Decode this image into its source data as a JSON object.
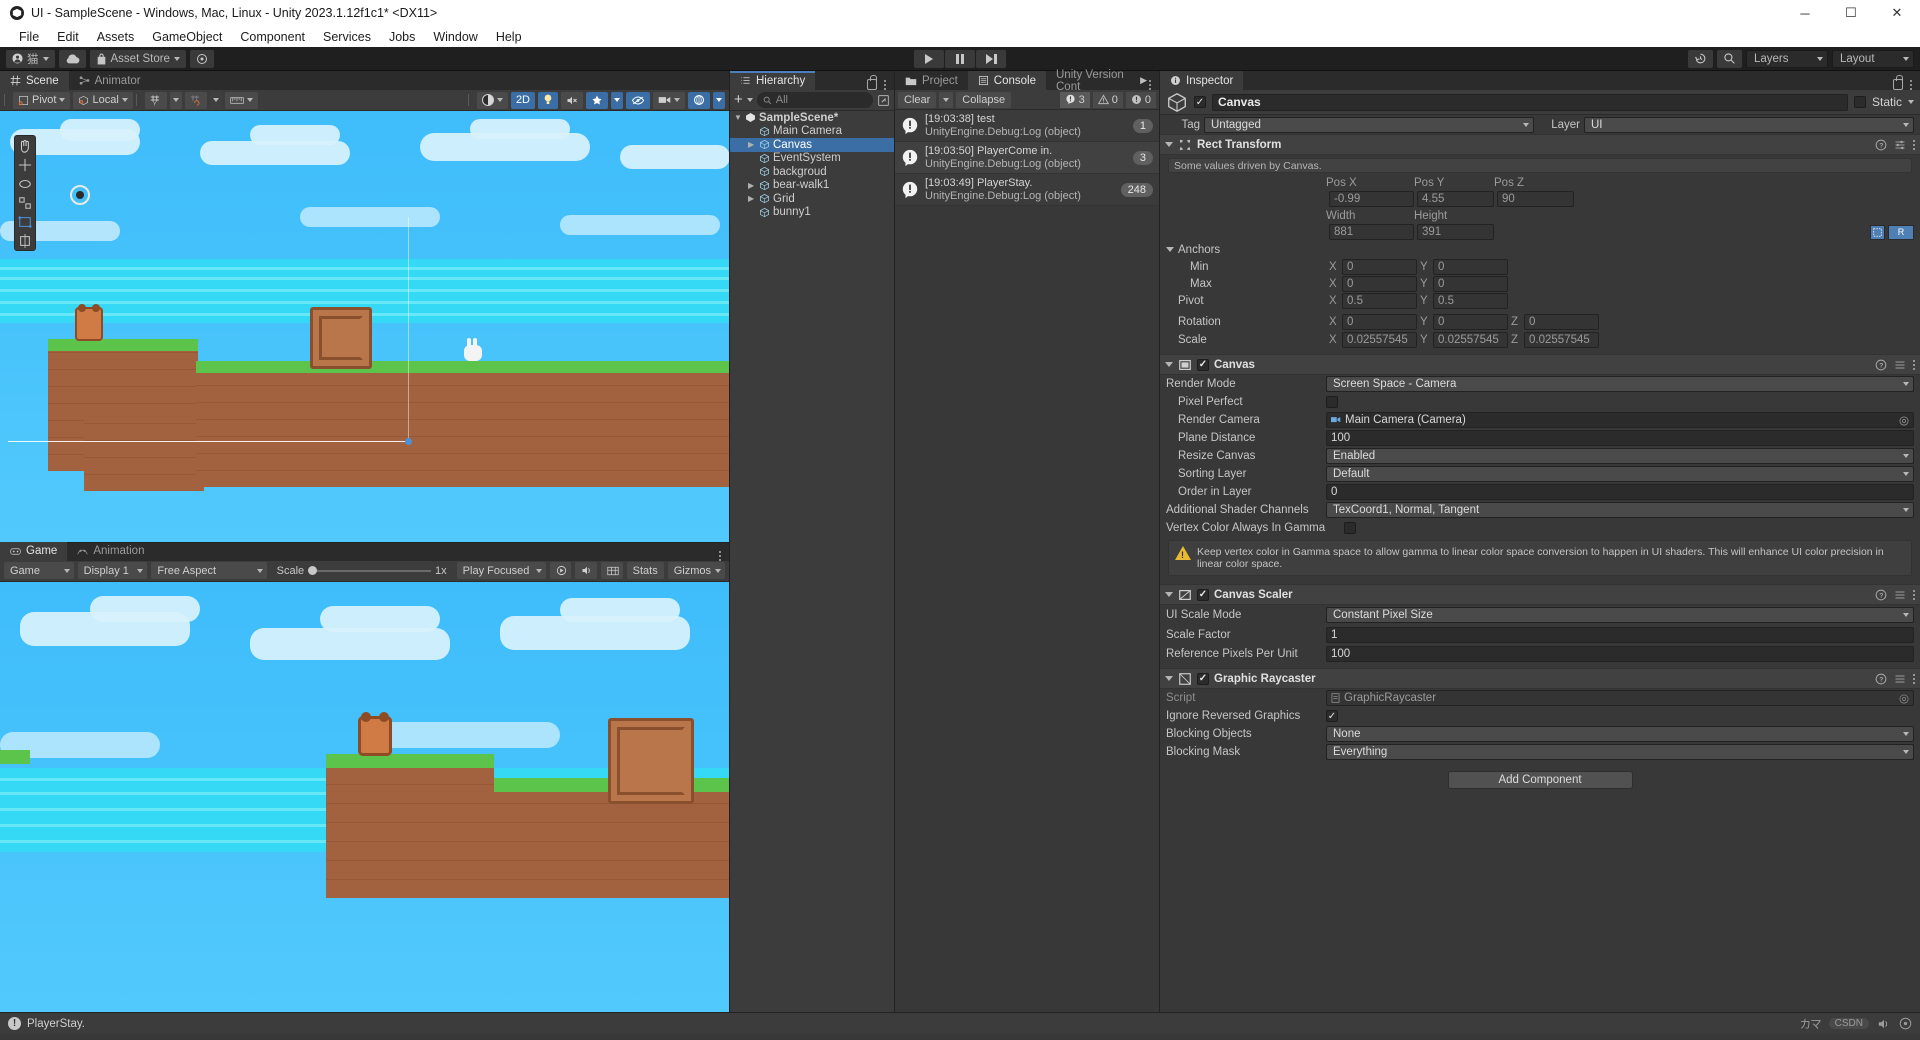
{
  "window": {
    "title": "UI - SampleScene - Windows, Mac, Linux - Unity 2023.1.12f1c1* <DX11>",
    "minimize": "─",
    "maximize": "☐",
    "close": "✕"
  },
  "menubar": {
    "items": [
      "File",
      "Edit",
      "Assets",
      "GameObject",
      "Component",
      "Services",
      "Jobs",
      "Window",
      "Help"
    ]
  },
  "toolbar": {
    "account_label": "猫",
    "cloud_icon": "cloud-icon",
    "asset_store_label": "Asset Store",
    "settings_icon": "gear-icon",
    "play_icon": "play-icon",
    "pause_icon": "pause-icon",
    "step_icon": "step-icon",
    "history_icon": "undo-history-icon",
    "search_icon": "search-icon",
    "layers_label": "Layers",
    "layout_label": "Layout"
  },
  "scene_panel": {
    "tabs": [
      {
        "label": "Scene",
        "icon": "grid-icon",
        "active": true
      },
      {
        "label": "Animator",
        "icon": "animator-icon",
        "active": false
      }
    ],
    "toolbar": {
      "pivot_label": "Pivot",
      "local_label": "Local",
      "grid_icon": "grid-snap-icon",
      "snap_icon": "snap-increment-icon",
      "ruler_icon": "ruler-icon",
      "shading_icon": "shading-mode-icon",
      "two_d_label": "2D",
      "light_icon": "light-icon",
      "audio_icon": "audio-mute-icon",
      "fx_icon": "effects-icon",
      "hidden_icon": "scene-visibility-icon",
      "camera_icon": "scene-camera-icon",
      "gizmos_icon": "gizmos-icon"
    }
  },
  "game_panel": {
    "tabs": [
      {
        "label": "Game",
        "icon": "game-icon",
        "active": true
      },
      {
        "label": "Animation",
        "icon": "animation-icon",
        "active": false
      }
    ],
    "toolbar": {
      "target_label": "Game",
      "display_label": "Display 1",
      "aspect_label": "Free Aspect",
      "scale_label": "Scale",
      "scale_value": "1x",
      "play_mode_label": "Play Focused",
      "mute_icon": "mute-audio-icon",
      "stats_label": "Stats",
      "gizmos_label": "Gizmos"
    }
  },
  "hierarchy": {
    "tab_label": "Hierarchy",
    "lock_icon": "lock-icon",
    "add_label": "+",
    "search_placeholder": "All",
    "items": [
      {
        "label": "SampleScene*",
        "depth": 0,
        "arrow": "down",
        "icon": "unity-scene-icon",
        "selected": false,
        "bold": true
      },
      {
        "label": "Main Camera",
        "depth": 1,
        "arrow": "",
        "icon": "gameobject-icon",
        "selected": false,
        "bold": false
      },
      {
        "label": "Canvas",
        "depth": 1,
        "arrow": "right",
        "icon": "gameobject-icon",
        "selected": true,
        "bold": false
      },
      {
        "label": "EventSystem",
        "depth": 1,
        "arrow": "",
        "icon": "gameobject-icon",
        "selected": false,
        "bold": false
      },
      {
        "label": "backgroud",
        "depth": 1,
        "arrow": "",
        "icon": "gameobject-icon",
        "selected": false,
        "bold": false
      },
      {
        "label": "bear-walk1",
        "depth": 1,
        "arrow": "right",
        "icon": "gameobject-icon",
        "selected": false,
        "bold": false
      },
      {
        "label": "Grid",
        "depth": 1,
        "arrow": "right",
        "icon": "gameobject-icon",
        "selected": false,
        "bold": false
      },
      {
        "label": "bunny1",
        "depth": 1,
        "arrow": "",
        "icon": "gameobject-icon",
        "selected": false,
        "bold": false
      }
    ]
  },
  "console": {
    "tabs": [
      {
        "label": "Project",
        "icon": "folder-icon",
        "active": false
      },
      {
        "label": "Console",
        "icon": "console-icon",
        "active": true
      },
      {
        "label": "Unity Version Cont",
        "icon": "",
        "active": false
      }
    ],
    "clear_label": "Clear",
    "collapse_label": "Collapse",
    "counts": {
      "log": "3",
      "warning": "0",
      "error": "0"
    },
    "messages": [
      {
        "line1": "[19:03:38] test",
        "line2": "UnityEngine.Debug:Log (object)",
        "count": "1"
      },
      {
        "line1": "[19:03:50] PlayerCome in.",
        "line2": "UnityEngine.Debug:Log (object)",
        "count": "3"
      },
      {
        "line1": "[19:03:49] PlayerStay.",
        "line2": "UnityEngine.Debug:Log (object)",
        "count": "248"
      }
    ]
  },
  "inspector": {
    "tab_label": "Inspector",
    "object_name": "Canvas",
    "static_label": "Static",
    "tag_label": "Tag",
    "tag_value": "Untagged",
    "layer_label": "Layer",
    "layer_value": "UI",
    "rect_transform": {
      "title": "Rect Transform",
      "driven_note": "Some values driven by Canvas.",
      "pos_x_label": "Pos X",
      "pos_y_label": "Pos Y",
      "pos_z_label": "Pos Z",
      "pos_x": "-0.99",
      "pos_y": "4.55",
      "pos_z": "90",
      "width_label": "Width",
      "height_label": "Height",
      "width": "881",
      "height": "391",
      "anchors_label": "Anchors",
      "min_label": "Min",
      "max_label": "Max",
      "pivot_label": "Pivot",
      "min_x": "0",
      "min_y": "0",
      "max_x": "0",
      "max_y": "0",
      "pivot_x": "0.5",
      "pivot_y": "0.5",
      "rotation_label": "Rotation",
      "rot_x": "0",
      "rot_y": "0",
      "rot_z": "0",
      "scale_label": "Scale",
      "scale_x": "0.02557545",
      "scale_y": "0.02557545",
      "scale_z": "0.02557545",
      "blueprint_icon": "blueprint-mode-icon",
      "raw_label": "R"
    },
    "canvas": {
      "title": "Canvas",
      "render_mode_label": "Render Mode",
      "render_mode_value": "Screen Space - Camera",
      "pixel_perfect_label": "Pixel Perfect",
      "render_camera_label": "Render Camera",
      "render_camera_value": "Main Camera (Camera)",
      "plane_distance_label": "Plane Distance",
      "plane_distance_value": "100",
      "resize_canvas_label": "Resize Canvas",
      "resize_canvas_value": "Enabled",
      "sorting_layer_label": "Sorting Layer",
      "sorting_layer_value": "Default",
      "order_in_layer_label": "Order in Layer",
      "order_in_layer_value": "0",
      "additional_shader_label": "Additional Shader Channels",
      "additional_shader_value": "TexCoord1, Normal, Tangent",
      "vertex_color_label": "Vertex Color Always In Gamma",
      "warning_text": "Keep vertex color in Gamma space to allow gamma to linear color space conversion to happen in UI shaders. This will enhance UI color precision in linear color space."
    },
    "canvas_scaler": {
      "title": "Canvas Scaler",
      "ui_scale_mode_label": "UI Scale Mode",
      "ui_scale_mode_value": "Constant Pixel Size",
      "scale_factor_label": "Scale Factor",
      "scale_factor_value": "1",
      "ref_ppu_label": "Reference Pixels Per Unit",
      "ref_ppu_value": "100"
    },
    "graphic_raycaster": {
      "title": "Graphic Raycaster",
      "script_label": "Script",
      "script_value": "GraphicRaycaster",
      "ignore_reversed_label": "Ignore Reversed Graphics",
      "blocking_objects_label": "Blocking Objects",
      "blocking_objects_value": "None",
      "blocking_mask_label": "Blocking Mask",
      "blocking_mask_value": "Everything"
    },
    "add_component_label": "Add Component"
  },
  "statusbar": {
    "message": "PlayerStay.",
    "icon": "console-log-icon",
    "right_icons": [
      "input-method-icon",
      "csdn-icon",
      "sound-icon",
      "accessibility-icon"
    ]
  },
  "colors": {
    "accent_blue": "#3a6ea5",
    "panel_bg": "#383838",
    "toolbar_bg": "#3c3c3c",
    "dark_bg": "#1f1f1f",
    "sky": "#3fbdfb",
    "water": "#35d8f5",
    "grass": "#5cc44a",
    "dirt": "#9b5a38"
  }
}
